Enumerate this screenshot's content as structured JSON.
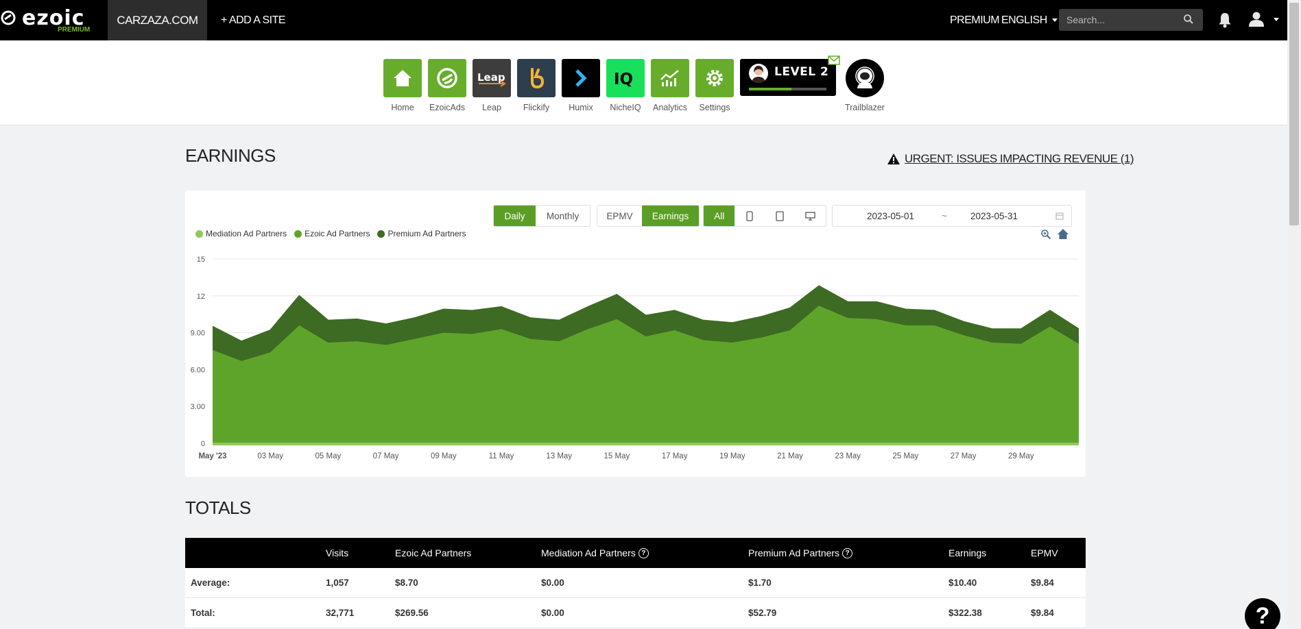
{
  "topbar": {
    "logo_text": "ezoic",
    "logo_sub": "PREMIUM",
    "site": "CARZAZA.COM",
    "add_site": "+ ADD A SITE",
    "premium": "PREMIUM",
    "language": "ENGLISH",
    "search_placeholder": "Search..."
  },
  "apps": [
    {
      "label": "Home",
      "icon": "home-icon",
      "bg": "#67ad2b"
    },
    {
      "label": "EzoicAds",
      "icon": "ezoicads-icon",
      "bg": "#67ad2b"
    },
    {
      "label": "Leap",
      "icon": "leap-icon",
      "bg": "#3d3d3d"
    },
    {
      "label": "Flickify",
      "icon": "flickify-icon",
      "bg": "#2d3e4e"
    },
    {
      "label": "Humix",
      "icon": "humix-icon",
      "bg": "#000000"
    },
    {
      "label": "NicheIQ",
      "icon": "nicheiq-icon",
      "bg": "#18e05a"
    },
    {
      "label": "Analytics",
      "icon": "analytics-icon",
      "bg": "#67ad2b"
    },
    {
      "label": "Settings",
      "icon": "settings-icon",
      "bg": "#67ad2b"
    }
  ],
  "level": {
    "text": "LEVEL 2",
    "progress": 0.55
  },
  "trailblazer": {
    "label": "Trailblazer"
  },
  "earnings": {
    "title": "EARNINGS",
    "urgent": "URGENT: ISSUES IMPACTING REVENUE (1)",
    "period_buttons": [
      {
        "label": "Daily",
        "active": true
      },
      {
        "label": "Monthly",
        "active": false
      }
    ],
    "metric_buttons": [
      {
        "label": "EPMV",
        "active": false
      },
      {
        "label": "Earnings",
        "active": true
      }
    ],
    "device_all": "All",
    "date_start": "2023-05-01",
    "date_sep": "~",
    "date_end": "2023-05-31"
  },
  "chart_data": {
    "type": "area",
    "stacked": true,
    "x": [
      "2023-05-01",
      "2023-05-02",
      "2023-05-03",
      "2023-05-04",
      "2023-05-05",
      "2023-05-06",
      "2023-05-07",
      "2023-05-08",
      "2023-05-09",
      "2023-05-10",
      "2023-05-11",
      "2023-05-12",
      "2023-05-13",
      "2023-05-14",
      "2023-05-15",
      "2023-05-16",
      "2023-05-17",
      "2023-05-18",
      "2023-05-19",
      "2023-05-20",
      "2023-05-21",
      "2023-05-22",
      "2023-05-23",
      "2023-05-24",
      "2023-05-25",
      "2023-05-26",
      "2023-05-27",
      "2023-05-28",
      "2023-05-29",
      "2023-05-30",
      "2023-05-31"
    ],
    "series": [
      {
        "name": "Mediation Ad Partners",
        "color": "#8fc95a",
        "values": [
          0,
          0,
          0,
          0,
          0,
          0,
          0,
          0,
          0,
          0,
          0,
          0,
          0,
          0,
          0,
          0,
          0,
          0,
          0,
          0,
          0,
          0,
          0,
          0,
          0,
          0,
          0,
          0,
          0,
          0,
          0
        ]
      },
      {
        "name": "Ezoic Ad Partners",
        "color": "#5fa42a",
        "values": [
          7.6,
          6.7,
          7.4,
          9.6,
          8.2,
          8.3,
          8.0,
          8.5,
          9.0,
          8.9,
          9.3,
          8.5,
          8.3,
          9.3,
          10.1,
          8.7,
          9.2,
          8.4,
          8.2,
          8.6,
          9.2,
          11.2,
          10.2,
          10.1,
          9.6,
          9.6,
          8.8,
          8.2,
          8.1,
          9.5,
          8.1
        ]
      },
      {
        "name": "Premium Ad Partners",
        "color": "#3d6b23",
        "values": [
          1.9,
          1.6,
          1.8,
          2.4,
          1.8,
          1.8,
          1.7,
          1.7,
          1.9,
          1.9,
          1.8,
          1.7,
          1.7,
          1.8,
          2.0,
          1.7,
          1.6,
          1.6,
          1.6,
          1.7,
          1.8,
          1.6,
          1.3,
          1.4,
          1.3,
          1.2,
          1.1,
          1.1,
          1.2,
          1.3,
          1.2
        ]
      }
    ],
    "y_ticks": [
      "0",
      "3.00",
      "6.00",
      "9.00",
      "12",
      "15"
    ],
    "x_ticks": [
      "May '23",
      "03 May",
      "05 May",
      "07 May",
      "09 May",
      "11 May",
      "13 May",
      "15 May",
      "17 May",
      "19 May",
      "21 May",
      "23 May",
      "25 May",
      "27 May",
      "29 May"
    ],
    "ylim": [
      0,
      15
    ],
    "grid": true,
    "legend_position": "top-left"
  },
  "totals": {
    "title": "TOTALS",
    "headers": [
      "",
      "Visits",
      "Ezoic Ad Partners",
      "Mediation Ad Partners",
      "Premium Ad Partners",
      "Earnings",
      "EPMV"
    ],
    "rows": [
      [
        "Average:",
        "1,057",
        "$8.70",
        "$0.00",
        "$1.70",
        "$10.40",
        "$9.84"
      ],
      [
        "Total:",
        "32,771",
        "$269.56",
        "$0.00",
        "$52.79",
        "$322.38",
        "$9.84"
      ]
    ]
  }
}
